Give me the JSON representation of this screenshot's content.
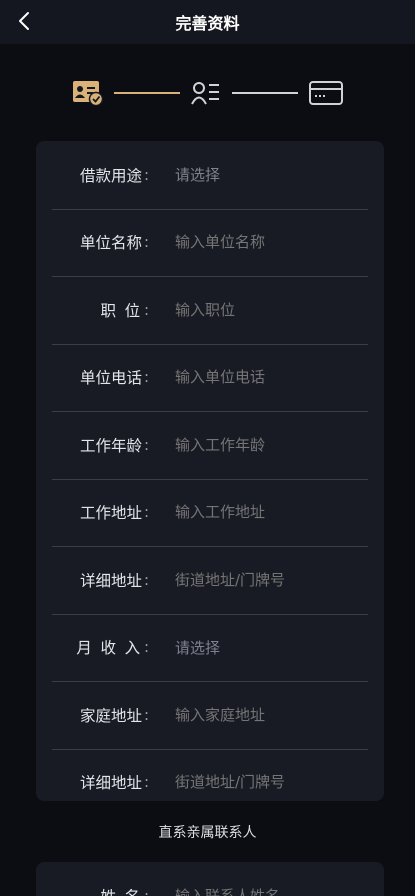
{
  "header": {
    "title": "完善资料"
  },
  "steps": {
    "icons": [
      "id-card-check-icon",
      "profile-list-icon",
      "bank-card-icon"
    ],
    "active_color": "#d9b27a",
    "inactive_color": "#cfd2d8"
  },
  "form": {
    "rows": [
      {
        "label": "借款用途",
        "colon": ":",
        "placeholder": "请选择"
      },
      {
        "label": "单位名称",
        "colon": ":",
        "placeholder": "输入单位名称"
      },
      {
        "label": "职 位",
        "colon": ":",
        "placeholder": "输入职位"
      },
      {
        "label": "单位电话",
        "colon": ":",
        "placeholder": "输入单位电话"
      },
      {
        "label": "工作年龄",
        "colon": ":",
        "placeholder": "输入工作年龄"
      },
      {
        "label": "工作地址",
        "colon": ":",
        "placeholder": "输入工作地址"
      },
      {
        "label": "详细地址",
        "colon": ":",
        "placeholder": "街道地址/门牌号"
      },
      {
        "label": "月 收 入",
        "colon": ":",
        "placeholder": "请选择"
      },
      {
        "label": "家庭地址",
        "colon": ":",
        "placeholder": "输入家庭地址"
      },
      {
        "label": "详细地址",
        "colon": ":",
        "placeholder": "街道地址/门牌号"
      }
    ]
  },
  "contact": {
    "section_title": "直系亲属联系人",
    "rows": [
      {
        "label": "姓 名",
        "colon": ":",
        "placeholder": "输入联系人姓名"
      }
    ]
  }
}
